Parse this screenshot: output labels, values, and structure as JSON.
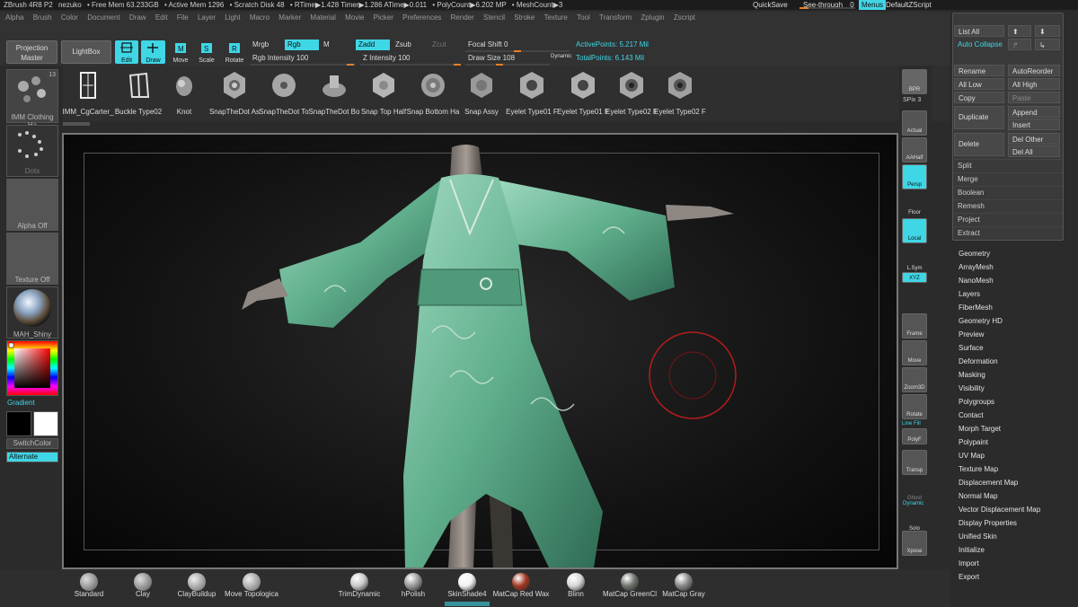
{
  "titlebar": {
    "items": [
      "ZBrush 4R8 P2",
      "nezuko",
      "• Free Mem 63.233GB",
      "• Active Mem 1296",
      "• Scratch Disk 48",
      "• RTime▶1.428 Timer▶1.286 ATime▶0.011",
      "• PolyCount▶6.202 MP",
      "• MeshCount▶3"
    ],
    "quicksave": "QuickSave",
    "see_through": "See-through",
    "see_through_value": "0",
    "menus": "Menus",
    "default_zscript": "DefaultZScript"
  },
  "menubar": [
    "Alpha",
    "Brush",
    "Color",
    "Document",
    "Draw",
    "Edit",
    "File",
    "Layer",
    "Light",
    "Macro",
    "Marker",
    "Material",
    "Movie",
    "Picker",
    "Preferences",
    "Render",
    "Stencil",
    "Stroke",
    "Texture",
    "Tool",
    "Transform",
    "Zplugin",
    "Zscript"
  ],
  "toolbar": {
    "projection_master": "Projection Master",
    "lightbox": "LightBox",
    "edit": "Edit",
    "draw": "Draw",
    "move": "Move",
    "scale": "Scale",
    "rotate": "Rotate",
    "mrgb": "Mrgb",
    "rgb": "Rgb",
    "m": "M",
    "zadd": "Zadd",
    "zsub": "Zsub",
    "zcut": "Zcut",
    "rgb_intensity": "Rgb Intensity 100",
    "z_intensity": "Z Intensity 100",
    "focal_shift": "Focal Shift 0",
    "draw_size": "Draw Size 108",
    "dynamic": "Dynamic",
    "active_points": "ActivePoints: 5.217 Mil",
    "total_points": "TotalPoints: 6.143 Mil"
  },
  "shelf": {
    "count": "13",
    "items": [
      "IMM_CgCarter_",
      "Buckle Type02",
      "Knot",
      "SnapTheDot As",
      "SnapTheDot To",
      "SnapTheDot Bo",
      "Snap Top Half",
      "Snap Bottom Ha",
      "Snap Assy",
      "Eyelet Type01 F",
      "Eyelet Type01 F",
      "Eyelet Type02 F",
      "Eyelet Type02 F"
    ]
  },
  "leftpanel": {
    "brush_label": "IMM Clothing Ha",
    "stroke_label": "Dots",
    "alpha_label": "Alpha Off",
    "texture_label": "Texture Off",
    "material_label": "MAH_Shiny",
    "gradient": "Gradient",
    "switchcolor": "SwitchColor",
    "alternate": "Alternate"
  },
  "rightstrip": {
    "bpr": "BPR",
    "spix": "SPix 3",
    "actual": "Actual",
    "aahalf": "AAHalf",
    "persp": "Persp",
    "floor": "Floor",
    "local": "Local",
    "lsym": "L.Sym",
    "xyz": "XYZ",
    "frame": "Frame",
    "move": "Move",
    "zoom3d": "Zoom3D",
    "rotate": "Rotate",
    "linefill": "Line Fill",
    "polyf": "PolyF",
    "transp": "Transp",
    "ghost": "Ghost",
    "dynamic": "Dynamic",
    "solo": "Solo",
    "xpose": "Xpose"
  },
  "bottombar": {
    "brushes": [
      "Standard",
      "Clay",
      "ClayBuildup",
      "Move Topologica"
    ],
    "materials": [
      "TrimDynamic",
      "hPolish",
      "SkinShade4",
      "MatCap Red Wax",
      "Blinn",
      "MatCap GreenCl",
      "MatCap Gray"
    ],
    "material_colors": [
      "#c9c9c9",
      "#9a9a9a",
      "#f2f2f2",
      "#a33a24",
      "#d8d8d8",
      "#6f756d",
      "#8a8a8a"
    ]
  },
  "subtool": {
    "list_all": "List All",
    "auto_collapse": "Auto Collapse",
    "rename": "Rename",
    "auto_reorder": "AutoReorder",
    "all_low": "All Low",
    "all_high": "All High",
    "copy": "Copy",
    "paste": "Paste",
    "duplicate": "Duplicate",
    "append": "Append",
    "insert": "Insert",
    "delete": "Delete",
    "del_other": "Del Other",
    "del_all": "Del All",
    "sections": [
      "Split",
      "Merge",
      "Boolean",
      "Remesh",
      "Project",
      "Extract"
    ]
  },
  "tool_menu": [
    "Geometry",
    "ArrayMesh",
    "NanoMesh",
    "Layers",
    "FiberMesh",
    "Geometry HD",
    "Preview",
    "Surface",
    "Deformation",
    "Masking",
    "Visibility",
    "Polygroups",
    "Contact",
    "Morph Target",
    "Polypaint",
    "UV Map",
    "Texture Map",
    "Displacement Map",
    "Normal Map",
    "Vector Displacement Map",
    "Display Properties",
    "Unified Skin",
    "Initialize",
    "Import",
    "Export"
  ],
  "colors": {
    "accent": "#3fd6e6",
    "slider": "#e57f2a",
    "garment": "#6fbf9a",
    "brush_cursor": "#b31c1c"
  }
}
